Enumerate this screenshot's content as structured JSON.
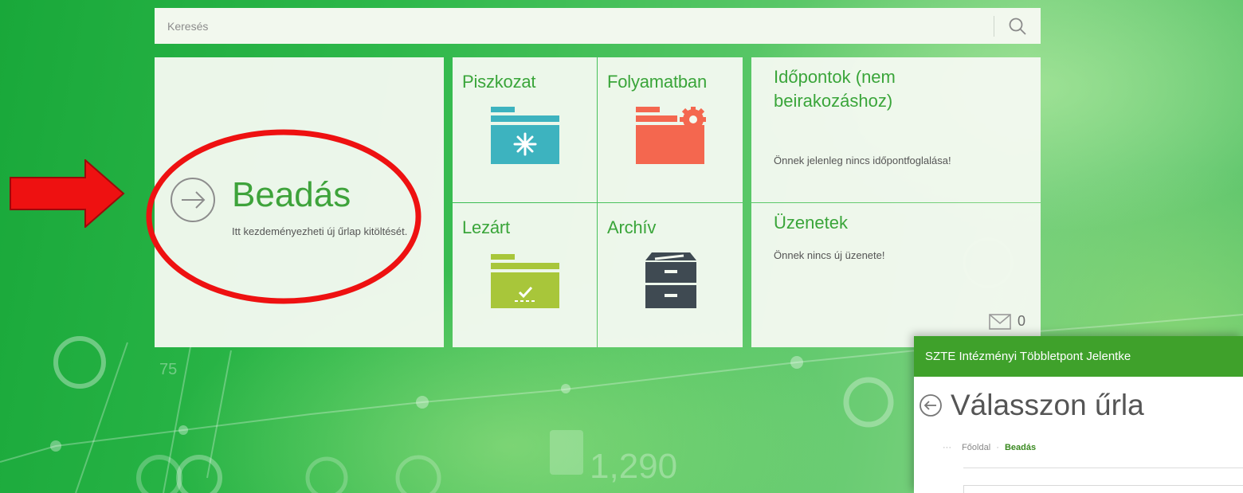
{
  "search": {
    "placeholder": "Keresés"
  },
  "tiles": {
    "beadas": {
      "title": "Beadás",
      "description": "Itt kezdeményezheti új űrlap kitöltését."
    },
    "piszkozat": {
      "label": "Piszkozat"
    },
    "folyamatban": {
      "label": "Folyamatban"
    },
    "lezart": {
      "label": "Lezárt"
    },
    "archiv": {
      "label": "Archív"
    },
    "idopontok": {
      "title": "Időpontok (nem beirakozáshoz)",
      "text": "Önnek jelenleg nincs időpontfoglalása!"
    },
    "uzenetek": {
      "title": "Üzenetek",
      "text": "Önnek nincs új üzenete!",
      "count": "0"
    }
  },
  "background_numbers": {
    "n75": "75",
    "n1290": "1,290"
  },
  "overlay": {
    "header": "SZTE Intézményi Többletpont Jelentke",
    "title": "Válasszon űrla",
    "breadcrumb": {
      "dots": "···",
      "home": "Főoldal",
      "separator": "·",
      "current": "Beadás"
    }
  },
  "colors": {
    "accent_green": "#3aa53a",
    "piszkozat_teal": "#3db3bf",
    "folyamatban_red": "#f4674f",
    "lezart_lime": "#a8c63a",
    "archiv_dark": "#3f4a52",
    "annotation_red": "#ee1111"
  },
  "icons": {
    "search": "search-icon",
    "beadas": "arrow-circle-right-icon",
    "piszkozat": "folder-star-icon",
    "folyamatban": "folder-gear-icon",
    "lezart": "folder-check-icon",
    "archiv": "archive-cabinet-icon",
    "mail": "envelope-icon",
    "back": "arrow-circle-left-icon"
  }
}
